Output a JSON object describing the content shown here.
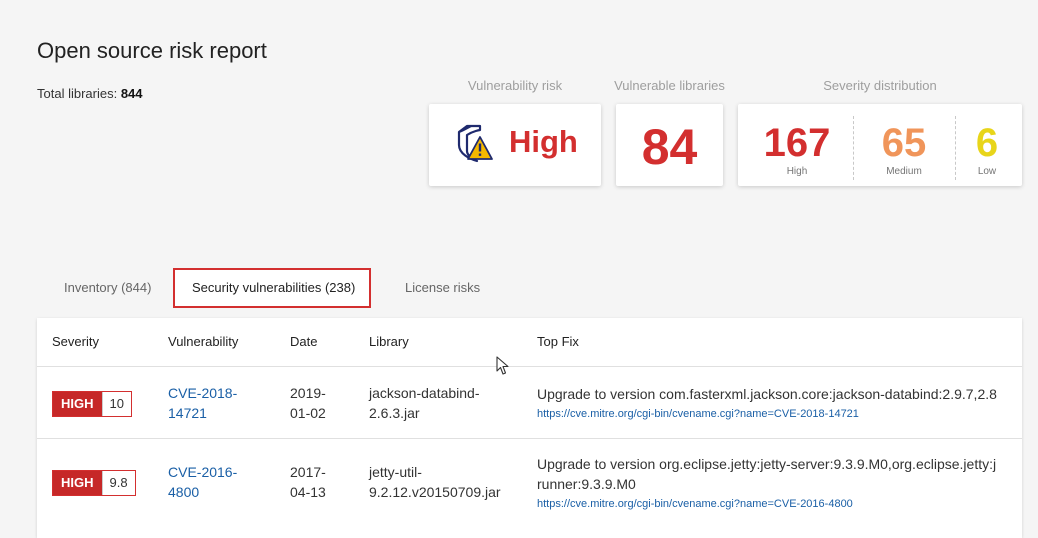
{
  "header": {
    "title": "Open source risk report",
    "total_label": "Total libraries:",
    "total_value": "844"
  },
  "kpis": {
    "vulnerability_risk": {
      "label": "Vulnerability risk",
      "value": "High",
      "icon": "shield-warning-icon"
    },
    "vulnerable_libraries": {
      "label": "Vulnerable libraries",
      "value": "84"
    },
    "severity_distribution": {
      "label": "Severity distribution",
      "items": [
        {
          "count": "167",
          "label": "High",
          "color": "#d32f2f"
        },
        {
          "count": "65",
          "label": "Medium",
          "color": "#f0955a"
        },
        {
          "count": "6",
          "label": "Low",
          "color": "#e8d51a"
        }
      ]
    }
  },
  "tabs": [
    {
      "label": "Inventory (844)"
    },
    {
      "label": "Security vulnerabilities (238)",
      "active": true
    },
    {
      "label": "License risks"
    }
  ],
  "table": {
    "columns": [
      "Severity",
      "Vulnerability",
      "Date",
      "Library",
      "Top Fix"
    ],
    "rows": [
      {
        "severity": "HIGH",
        "score": "10",
        "vuln_line1": "CVE-2018-",
        "vuln_line2": "14721",
        "date_line1": "2019-",
        "date_line2": "01-02",
        "lib_line1": "jackson-databind-",
        "lib_line2": "2.6.3.jar",
        "fix_line1": "Upgrade to version com.fasterxml.jackson.core:jackson-databind:2.9.7,2.8",
        "fix_line2": "",
        "fix_url": "https://cve.mitre.org/cgi-bin/cvename.cgi?name=CVE-2018-14721"
      },
      {
        "severity": "HIGH",
        "score": "9.8",
        "vuln_line1": "CVE-2016-",
        "vuln_line2": "4800",
        "date_line1": "2017-",
        "date_line2": "04-13",
        "lib_line1": "jetty-util-",
        "lib_line2": "9.2.12.v20150709.jar",
        "fix_line1": "Upgrade to version org.eclipse.jetty:jetty-server:9.3.9.M0,org.eclipse.jetty:j",
        "fix_line2": "runner:9.3.9.M0",
        "fix_url": "https://cve.mitre.org/cgi-bin/cvename.cgi?name=CVE-2016-4800"
      }
    ]
  }
}
